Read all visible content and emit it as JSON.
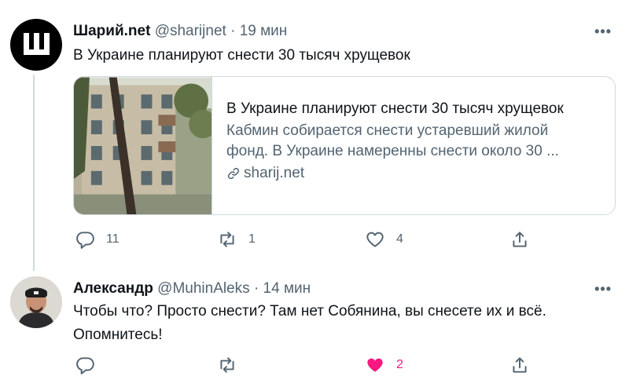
{
  "tweets": [
    {
      "author": "Шарий.net",
      "handle": "@sharijnet",
      "dot": "·",
      "time": "19 мин",
      "more": "•••",
      "avatar_glyph": "Ш",
      "text": "В Украине планируют снести 30 тысяч хрущевок",
      "card": {
        "title": "В Украине планируют снести 30 тысяч хрущевок",
        "desc_line1": "Кабмин собирается снести устаревший жилой",
        "desc_line2": "фонд. В Украине намеренны снести около 30 ...",
        "domain": "sharij.net"
      },
      "actions": {
        "replies": "11",
        "retweets": "1",
        "likes": "4"
      }
    },
    {
      "author": "Александр",
      "handle": "@MuhinAleks",
      "dot": "·",
      "time": "14 мин",
      "more": "•••",
      "text_line1": "Чтобы что? Просто снести? Там нет Собянина, вы снесете их и всё.",
      "text_line2": "Опомнитесь!",
      "actions": {
        "replies": "",
        "retweets": "",
        "likes": "2"
      }
    }
  ],
  "colors": {
    "text": "#0f1419",
    "secondary": "#536471",
    "like": "#f91880",
    "border": "#cfd9de"
  }
}
